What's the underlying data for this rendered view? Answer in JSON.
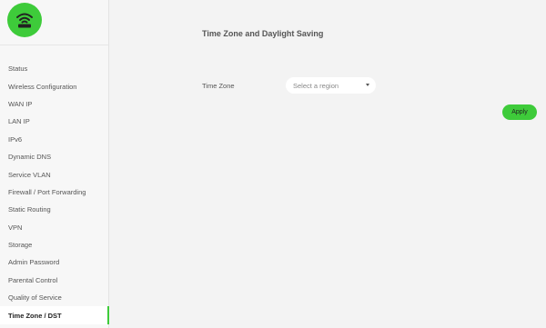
{
  "colors": {
    "accent": "#3ecb3a",
    "background": "#f3f3f3",
    "sidebar": "#f7f7f7"
  },
  "logo": {
    "icon": "wifi-router-icon"
  },
  "sidebar": {
    "items": [
      {
        "label": "Status",
        "active": false
      },
      {
        "label": "Wireless Configuration",
        "active": false
      },
      {
        "label": "WAN IP",
        "active": false
      },
      {
        "label": "LAN IP",
        "active": false
      },
      {
        "label": "IPv6",
        "active": false
      },
      {
        "label": "Dynamic DNS",
        "active": false
      },
      {
        "label": "Service VLAN",
        "active": false
      },
      {
        "label": "Firewall / Port Forwarding",
        "active": false
      },
      {
        "label": "Static Routing",
        "active": false
      },
      {
        "label": "VPN",
        "active": false
      },
      {
        "label": "Storage",
        "active": false
      },
      {
        "label": "Admin Password",
        "active": false
      },
      {
        "label": "Parental Control",
        "active": false
      },
      {
        "label": "Quality of Service",
        "active": false
      },
      {
        "label": "Time Zone / DST",
        "active": true
      }
    ]
  },
  "main": {
    "title": "Time Zone and Daylight Saving",
    "timezone": {
      "label": "Time Zone",
      "placeholder": "Select a region",
      "value": ""
    },
    "apply_label": "Apply"
  }
}
